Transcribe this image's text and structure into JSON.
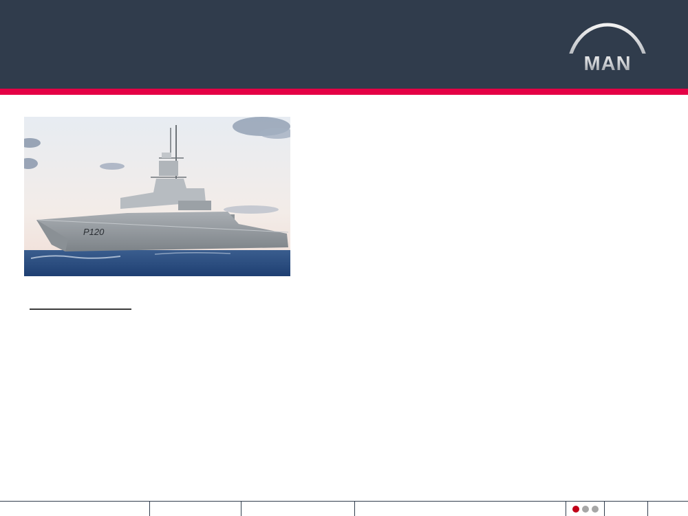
{
  "header": {
    "background_color": "#303c4c",
    "accent_color": "#e40045"
  },
  "logo": {
    "text": "MAN"
  },
  "photo": {
    "hull_number": "P120"
  },
  "footer": {
    "page_indicator": [
      "active",
      "inactive",
      "inactive"
    ],
    "dot_colors": {
      "active": "#c00018",
      "inactive": "#a6a6a6"
    }
  }
}
